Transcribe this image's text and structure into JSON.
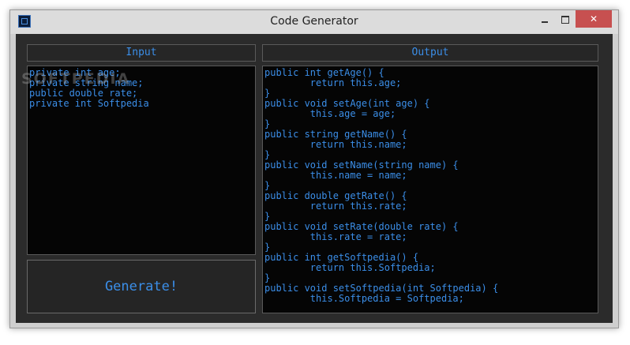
{
  "window": {
    "title": "Code Generator",
    "minimize_glyph": "",
    "maximize_glyph": "",
    "close_glyph": "✕",
    "app_icon": "app-icon"
  },
  "input_panel": {
    "header": "Input",
    "text": "private int age;\nprivate string name;\npublic double rate;\nprivate int Softpedia"
  },
  "output_panel": {
    "header": "Output",
    "text": "public int getAge() {\n        return this.age;\n}\npublic void setAge(int age) {\n        this.age = age;\n}\npublic string getName() {\n        return this.name;\n}\npublic void setName(string name) {\n        this.name = name;\n}\npublic double getRate() {\n        return this.rate;\n}\npublic void setRate(double rate) {\n        this.rate = rate;\n}\npublic int getSoftpedia() {\n        return this.Softpedia;\n}\npublic void setSoftpedia(int Softpedia) {\n        this.Softpedia = Softpedia;"
  },
  "generate_button": {
    "label": "Generate!"
  },
  "watermark": "SOFTPEDIA",
  "colors": {
    "accent": "#3b8ee8",
    "panel_bg": "#050505",
    "window_bg": "#2b2b2b",
    "close_btn": "#c75050"
  }
}
